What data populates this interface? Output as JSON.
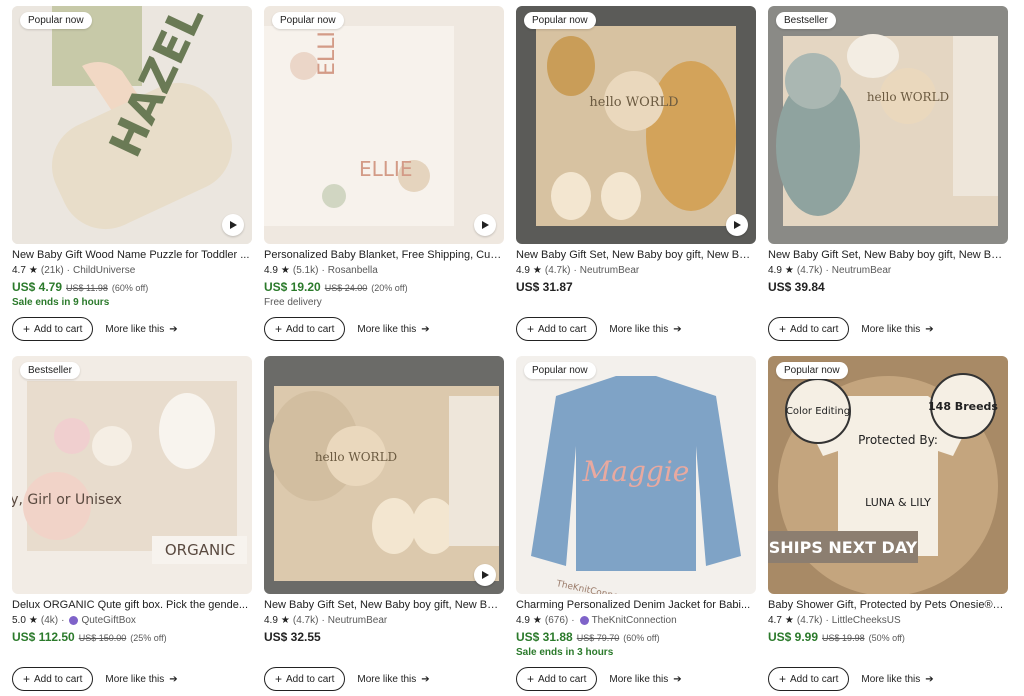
{
  "products": [
    {
      "badge": "Popular now",
      "title": "New Baby Gift Wood Name Puzzle for Toddler ...",
      "rating": "4.7",
      "reviews": "(21k)",
      "shop": "ChildUniverse",
      "shop_icon": false,
      "price": "US$ 4.79",
      "price_sale": true,
      "orig": "US$ 11.98",
      "pct": "(60% off)",
      "note": "Sale ends in 9 hours",
      "note_type": "sale",
      "video": true,
      "cart": "Add to cart",
      "more": "More like this",
      "bg": "#e9e4dc",
      "image_text": "HAZEL"
    },
    {
      "badge": "Popular now",
      "title": "Personalized Baby Blanket, Free Shipping, Cus...",
      "rating": "4.9",
      "reviews": "(5.1k)",
      "shop": "Rosanbella",
      "shop_icon": false,
      "price": "US$ 19.20",
      "price_sale": true,
      "orig": "US$ 24.00",
      "pct": "(20% off)",
      "note": "Free delivery",
      "note_type": "free",
      "video": true,
      "cart": "Add to cart",
      "more": "More like this",
      "bg": "#efe8e0",
      "image_text": "ELLIE"
    },
    {
      "badge": "Popular now",
      "title": "New Baby Gift Set, New Baby boy gift, New Ba...",
      "rating": "4.9",
      "reviews": "(4.7k)",
      "shop": "NeutrumBear",
      "shop_icon": false,
      "price": "US$ 31.87",
      "price_sale": false,
      "orig": "",
      "pct": "",
      "note": "",
      "note_type": "",
      "video": true,
      "cart": "Add to cart",
      "more": "More like this",
      "bg": "#5b5b58",
      "image_text": "hello WORLD"
    },
    {
      "badge": "Bestseller",
      "title": "New Baby Gift Set, New Baby boy gift, New Ba...",
      "rating": "4.9",
      "reviews": "(4.7k)",
      "shop": "NeutrumBear",
      "shop_icon": false,
      "price": "US$ 39.84",
      "price_sale": false,
      "orig": "",
      "pct": "",
      "note": "",
      "note_type": "",
      "video": false,
      "cart": "Add to cart",
      "more": "More like this",
      "bg": "#8a8a86",
      "image_text": "hello WORLD"
    },
    {
      "badge": "Bestseller",
      "title": "Delux ORGANIC Qute gift box. Pick the gende...",
      "rating": "5.0",
      "reviews": "(4k)",
      "shop": "QuteGiftBox",
      "shop_icon": true,
      "price": "US$ 112.50",
      "price_sale": true,
      "orig": "US$ 150.00",
      "pct": "(25% off)",
      "note": "",
      "note_type": "",
      "video": false,
      "cart": "Add to cart",
      "more": "More like this",
      "bg": "#f2ece5",
      "image_text": "Boy, Girl or Unisex",
      "image_text2": "ORGANIC"
    },
    {
      "badge": "",
      "title": "New Baby Gift Set, New Baby boy gift, New Ba...",
      "rating": "4.9",
      "reviews": "(4.7k)",
      "shop": "NeutrumBear",
      "shop_icon": false,
      "price": "US$ 32.55",
      "price_sale": false,
      "orig": "",
      "pct": "",
      "note": "",
      "note_type": "",
      "video": true,
      "cart": "Add to cart",
      "more": "More like this",
      "bg": "#6b6b68",
      "image_text": "hello WORLD"
    },
    {
      "badge": "Popular now",
      "title": "Charming Personalized Denim Jacket for Babi...",
      "rating": "4.9",
      "reviews": "(676)",
      "shop": "TheKnitConnection",
      "shop_icon": true,
      "price": "US$ 31.88",
      "price_sale": true,
      "orig": "US$ 79.70",
      "pct": "(60% off)",
      "note": "Sale ends in 3 hours",
      "note_type": "sale",
      "video": false,
      "cart": "Add to cart",
      "more": "More like this",
      "bg": "#f3f0ec",
      "image_text": "Maggie",
      "image_text2": "TheKnitConnection"
    },
    {
      "badge": "Popular now",
      "title": "Baby Shower Gift, Protected by Pets Onesie®, ...",
      "rating": "4.7",
      "reviews": "(4.7k)",
      "shop": "LittleCheeksUS",
      "shop_icon": false,
      "price": "US$ 9.99",
      "price_sale": true,
      "orig": "US$ 19.98",
      "pct": "(50% off)",
      "note": "",
      "note_type": "",
      "video": false,
      "cart": "Add to cart",
      "more": "More like this",
      "bg": "#a88a66",
      "image_text": "Protected By:",
      "image_text2": "SHIPS NEXT DAY",
      "image_text3": "148 Breeds",
      "image_text4": "Color Editing",
      "image_text5": "LUNA & LILY"
    }
  ],
  "icons": {
    "star": "star-icon",
    "play": "play-icon",
    "plus": "plus-icon",
    "arrow": "arrow-right-icon",
    "shop_badge": "shop-verified-icon"
  }
}
